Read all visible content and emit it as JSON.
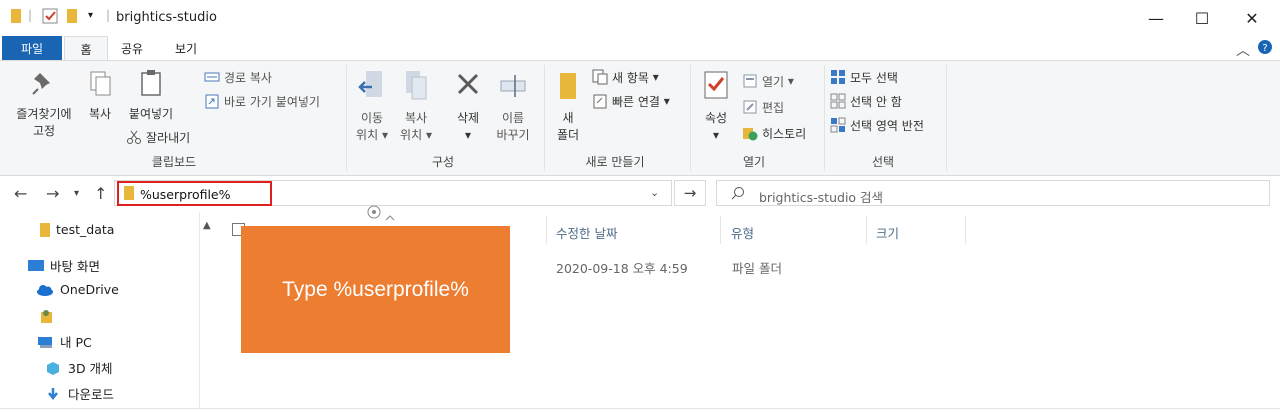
{
  "window": {
    "title": "brightics-studio",
    "controls": {
      "minimize": "—",
      "maximize": "☐",
      "close": "✕"
    }
  },
  "ribbon_tabs": {
    "file": "파일",
    "home": "홈",
    "share": "공유",
    "view": "보기"
  },
  "ribbon": {
    "clipboard": {
      "label": "클립보드",
      "pin_line1": "즐겨찾기에",
      "pin_line2": "고정",
      "copy": "복사",
      "paste": "붙여넣기",
      "cut": "잘라내기",
      "copy_path": "경로 복사",
      "paste_shortcut": "바로 가기 붙여넣기"
    },
    "organize": {
      "label": "구성",
      "move_line1": "이동",
      "move_line2": "위치",
      "copy_line1": "복사",
      "copy_line2": "위치",
      "delete": "삭제",
      "rename_line1": "이름",
      "rename_line2": "바꾸기"
    },
    "new": {
      "label": "새로 만들기",
      "folder_line1": "새",
      "folder_line2": "폴더",
      "new_item": "새 항목",
      "easy_access": "빠른 연결"
    },
    "open": {
      "label": "열기",
      "properties": "속성",
      "open": "열기",
      "edit": "편집",
      "history": "히스토리"
    },
    "select": {
      "label": "선택",
      "select_all": "모두 선택",
      "select_none": "선택 안 함",
      "invert": "선택 영역 반전"
    }
  },
  "address": {
    "value": "%userprofile%",
    "search_placeholder": "brightics-studio 검색"
  },
  "nav_pane": {
    "items": [
      {
        "label": "test_data"
      },
      {
        "label": "바탕 화면"
      },
      {
        "label": "OneDrive"
      },
      {
        "label": ""
      },
      {
        "label": "내 PC"
      },
      {
        "label": "3D 개체"
      },
      {
        "label": "다운로드"
      }
    ]
  },
  "columns": {
    "modified": "수정한 날짜",
    "type": "유형",
    "size": "크기"
  },
  "rows": [
    {
      "modified": "2020-09-18 오후 4:59",
      "type": "파일 폴더",
      "size": ""
    }
  ],
  "callout": {
    "text": "Type %userprofile%",
    "color": "#ed7d31"
  },
  "colors": {
    "file_tab": "#1a64b4",
    "highlight": "#e02020",
    "ribbon_bg": "#f5f6f7"
  }
}
